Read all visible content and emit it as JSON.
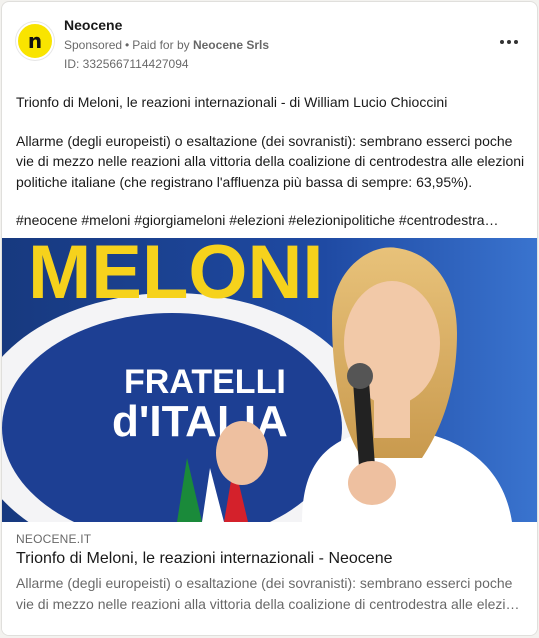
{
  "post": {
    "author": {
      "name": "Neocene",
      "avatar_glyph": "n"
    },
    "sponsored": "Sponsored",
    "paid_for_prefix": "Paid for by",
    "paid_for_by": "Neocene Srls",
    "ad_id": "ID: 3325667114427094",
    "more_icon": "more-horizontal-icon",
    "body": {
      "title_line": "Trionfo di Meloni, le reazioni internazionali - di William Lucio Chioccini",
      "paragraph": "Allarme (degli europeisti) o esaltazione (dei sovranisti): sembrano esserci poche vie di mezzo nelle reazioni alla vittoria della coalizione di centrodestra alle elezioni politiche italiane (che registrano l'affluenza più bassa di sempre: 63,95%).",
      "hashtags": "#neocene #meloni #giorgiameloni #elezioni #elezionipolitiche #centrodestra…"
    },
    "image": {
      "banner_text": "MELONI",
      "logo_line1": "FRATELLI",
      "logo_line2": "d'ITALIA"
    },
    "link": {
      "domain": "NEOCENE.IT",
      "title": "Trionfo di Meloni, le reazioni internazionali - Neocene",
      "desc_line1": "Allarme (degli europeisti) o esaltazione (dei sovranisti): sembrano esserci poche",
      "desc_line2": "vie di mezzo nelle reazioni alla vittoria della coalizione di centrodestra alle elezio…"
    }
  },
  "colors": {
    "avatar_bg": "#f9e400",
    "banner_blue": "#1f4aa3",
    "banner_yellow": "#f6d21c",
    "logo_white": "#ffffff"
  }
}
